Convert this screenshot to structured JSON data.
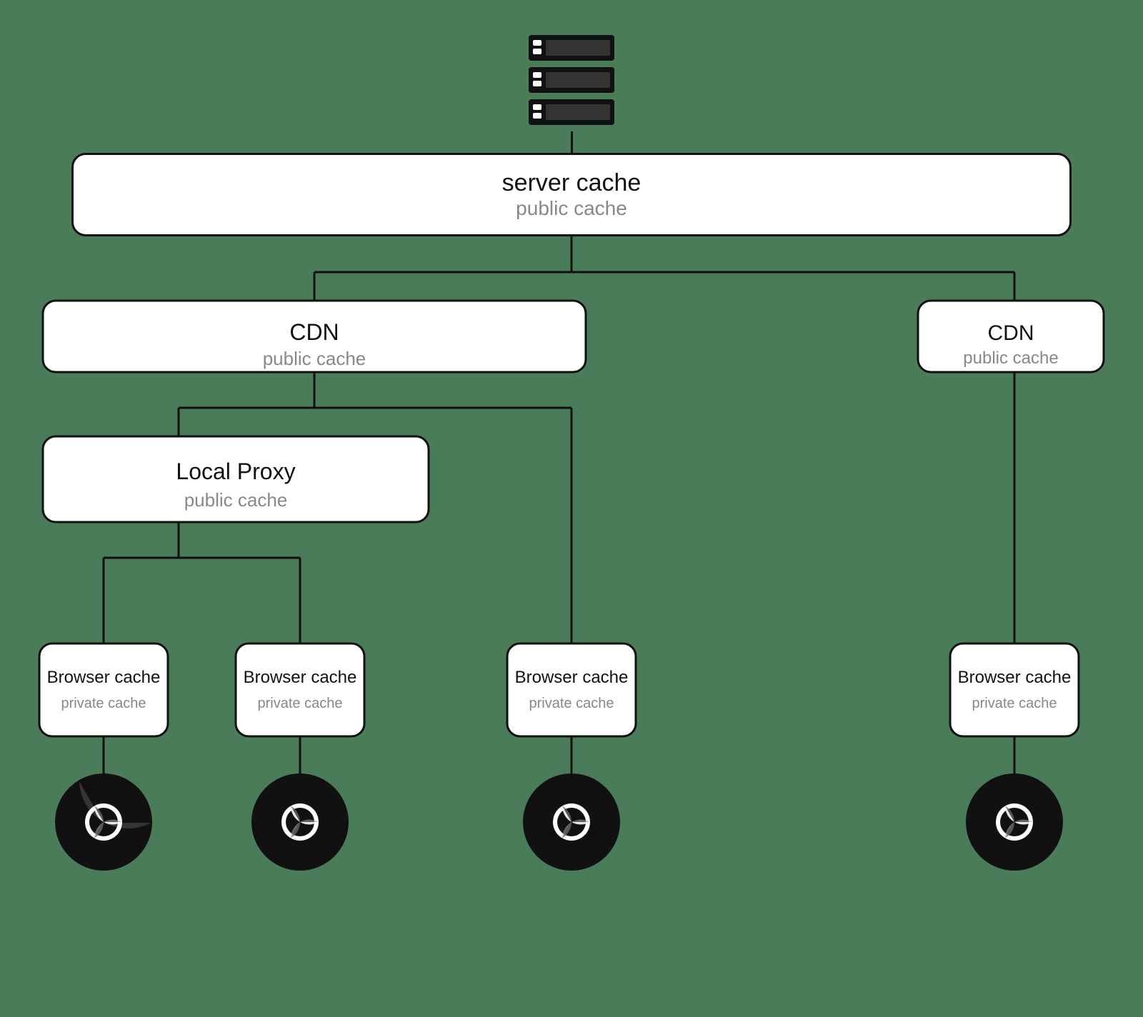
{
  "diagram": {
    "server": {
      "label": "server cache",
      "sublabel": "public cache"
    },
    "cdn_left": {
      "label": "CDN",
      "sublabel": "public cache"
    },
    "cdn_right": {
      "label": "CDN",
      "sublabel": "public cache"
    },
    "local_proxy": {
      "label": "Local Proxy",
      "sublabel": "public cache"
    },
    "browsers": [
      {
        "label": "Browser cache",
        "sublabel": "private cache"
      },
      {
        "label": "Browser cache",
        "sublabel": "private cache"
      },
      {
        "label": "Browser cache",
        "sublabel": "private cache"
      },
      {
        "label": "Browser cache",
        "sublabel": "private cache"
      }
    ]
  }
}
